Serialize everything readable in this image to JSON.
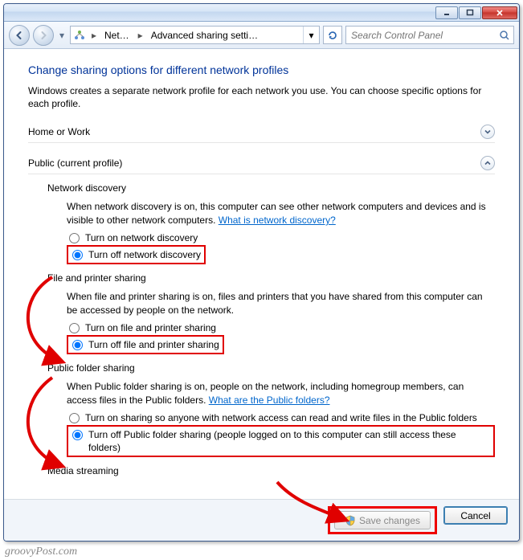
{
  "titlebar": {},
  "navbar": {
    "crumb1": "Net…",
    "crumb2": "Advanced sharing setti…",
    "search_placeholder": "Search Control Panel"
  },
  "page": {
    "title": "Change sharing options for different network profiles",
    "intro": "Windows creates a separate network profile for each network you use. You can choose specific options for each profile."
  },
  "sections": {
    "home": {
      "label": "Home or Work"
    },
    "public": {
      "label": "Public (current profile)"
    }
  },
  "nd": {
    "title": "Network discovery",
    "body_pre": "When network discovery is on, this computer can see other network computers and devices and is visible to other network computers. ",
    "link": "What is network discovery?",
    "opt_on": "Turn on network discovery",
    "opt_off": "Turn off network discovery"
  },
  "fp": {
    "title": "File and printer sharing",
    "body": "When file and printer sharing is on, files and printers that you have shared from this computer can be accessed by people on the network.",
    "opt_on": "Turn on file and printer sharing",
    "opt_off": "Turn off file and printer sharing"
  },
  "pf": {
    "title": "Public folder sharing",
    "body_pre": "When Public folder sharing is on, people on the network, including homegroup members, can access files in the Public folders. ",
    "link": "What are the Public folders?",
    "opt_on": "Turn on sharing so anyone with network access can read and write files in the Public folders",
    "opt_off": "Turn off Public folder sharing (people logged on to this computer can still access these folders)"
  },
  "ms": {
    "title": "Media streaming"
  },
  "buttons": {
    "save": "Save changes",
    "cancel": "Cancel"
  },
  "watermark": "groovyPost.com"
}
